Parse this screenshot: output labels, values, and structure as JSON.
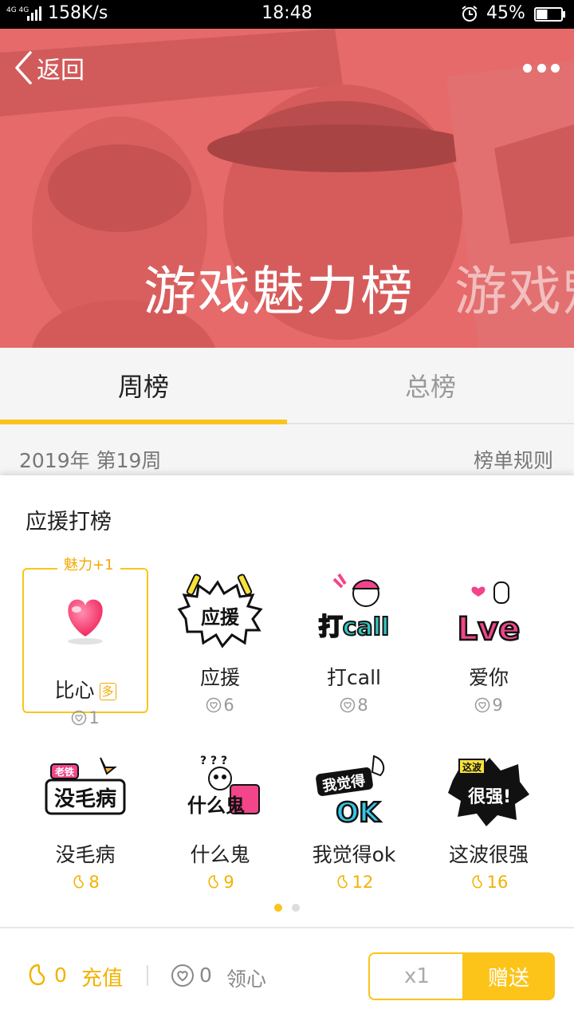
{
  "status_bar": {
    "network_top": "4G 4G",
    "speed": "158K/s",
    "time": "18:48",
    "battery_percent": "45%",
    "battery_level": 0.45
  },
  "header": {
    "back_label": "返回",
    "banner_title": "游戏魅力榜",
    "banner_title_peek": "游戏魅"
  },
  "tabs": [
    {
      "label": "周榜",
      "active": true
    },
    {
      "label": "总榜",
      "active": false
    }
  ],
  "week": {
    "label": "2019年 第19周",
    "rules_label": "榜单规则"
  },
  "sheet": {
    "title": "应援打榜",
    "charm_tag": "魅力+1",
    "multi_tag": "多",
    "gifts": [
      {
        "name": "比心",
        "price": "1",
        "currency": "heart",
        "icon": "heart-gift-icon",
        "selected": true
      },
      {
        "name": "应援",
        "price": "6",
        "currency": "heart",
        "icon": "cheer-sticker-icon"
      },
      {
        "name": "打call",
        "price": "8",
        "currency": "heart",
        "icon": "dacall-sticker-icon"
      },
      {
        "name": "爱你",
        "price": "9",
        "currency": "heart",
        "icon": "love-sticker-icon"
      },
      {
        "name": "没毛病",
        "price": "8",
        "currency": "bean",
        "icon": "meimaobing-sticker-icon",
        "sticker_text": "没毛病",
        "sticker_small": "老铁"
      },
      {
        "name": "什么鬼",
        "price": "9",
        "currency": "bean",
        "icon": "shenmegui-sticker-icon",
        "sticker_text": "什么鬼"
      },
      {
        "name": "我觉得ok",
        "price": "12",
        "currency": "bean",
        "icon": "ok-sticker-icon",
        "sticker_text": "我觉得",
        "sticker_ok": "OK"
      },
      {
        "name": "这波很强",
        "price": "16",
        "currency": "bean",
        "icon": "henqiang-sticker-icon",
        "sticker_text": "很强!",
        "sticker_small": "这波"
      }
    ],
    "page_index": 0,
    "page_count": 2,
    "sticker_texts": {
      "cheer": "应援",
      "dacall": "打call",
      "love": "Lve"
    }
  },
  "bottom_bar": {
    "bean_count": "0",
    "recharge_label": "充值",
    "heart_count": "0",
    "collect_label": "领心",
    "quantity": "x1",
    "send_label": "赠送"
  },
  "colors": {
    "accent": "#fcc419",
    "banner": "#e66a6a",
    "bean": "#f2b200"
  }
}
